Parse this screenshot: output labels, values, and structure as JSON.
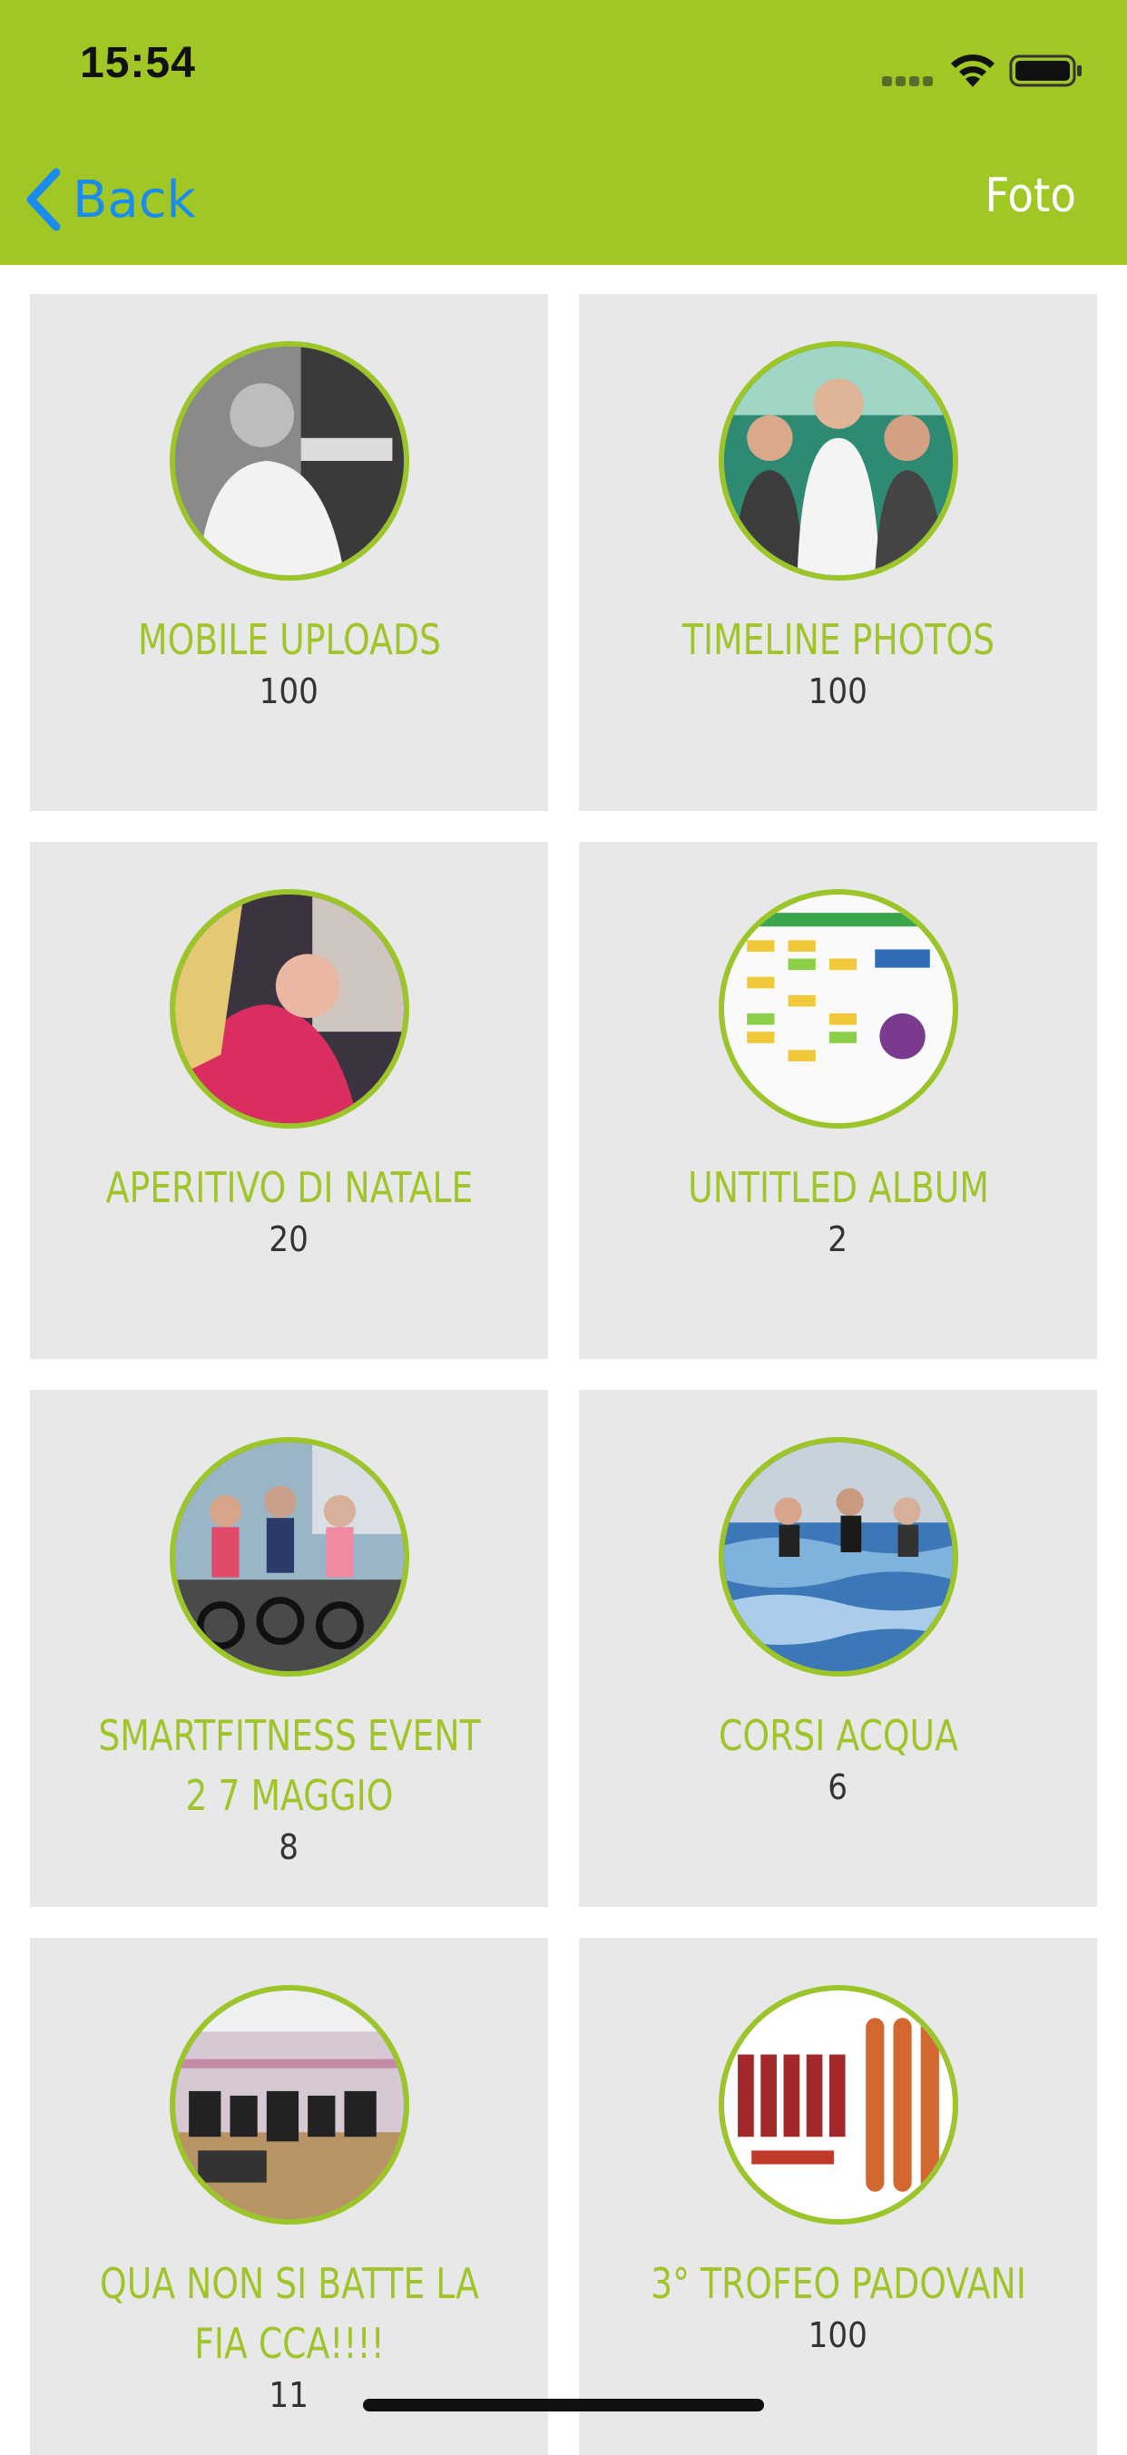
{
  "status_bar": {
    "time": "15:54"
  },
  "nav": {
    "back_label": "Back",
    "title": "Foto"
  },
  "albums": [
    {
      "name": "MOBILE UPLOADS",
      "count": "100",
      "thumb_icon": "man-portrait-photo"
    },
    {
      "name": "TIMELINE PHOTOS",
      "count": "100",
      "thumb_icon": "group-photo"
    },
    {
      "name": "APERITIVO DI NATALE",
      "count": "20",
      "thumb_icon": "woman-photo"
    },
    {
      "name": "UNTITLED ALBUM",
      "count": "2",
      "thumb_icon": "schedule-poster-photo"
    },
    {
      "name": "SMARTFITNESS EVENT 2 7 MAGGIO",
      "count": "8",
      "thumb_icon": "spinning-class-photo"
    },
    {
      "name": "CORSI ACQUA",
      "count": "6",
      "thumb_icon": "pool-class-photo"
    },
    {
      "name": "QUA NON SI BATTE LA FIA CCA!!!!",
      "count": "11",
      "thumb_icon": "gym-room-photo"
    },
    {
      "name": "3° TROFEO PADOVANI",
      "count": "100",
      "thumb_icon": "sponsor-logo-photo"
    }
  ],
  "colors": {
    "header_bg": "#a0c723",
    "accent_green": "#a0c52a",
    "back_blue": "#1a8cf0",
    "card_bg": "#e8e8e8"
  }
}
